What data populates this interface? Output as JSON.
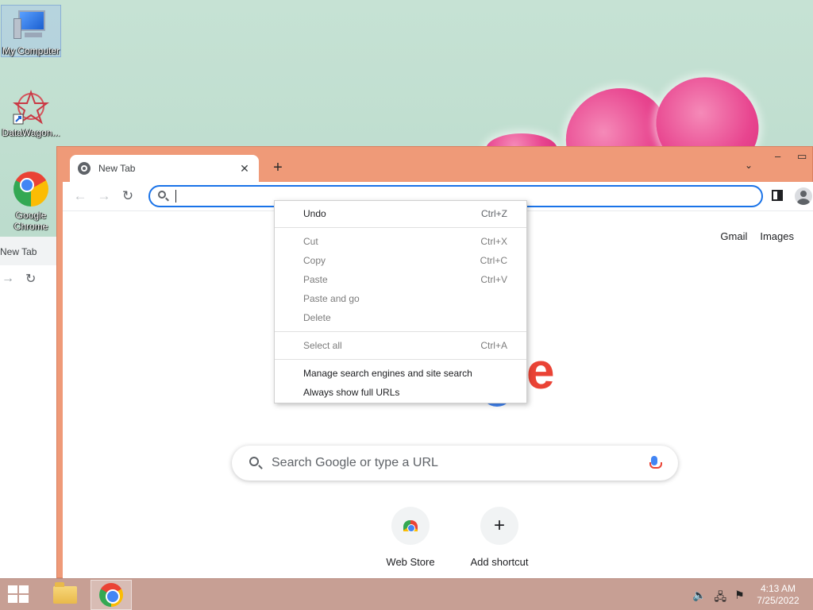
{
  "desktop": {
    "icons": [
      {
        "label": "My Computer"
      },
      {
        "label": "DataWagon..."
      },
      {
        "label": "Google Chrome"
      }
    ]
  },
  "background_window": {
    "tab_label": "New Tab"
  },
  "browser": {
    "tab": {
      "title": "New Tab",
      "close": "✕"
    },
    "new_tab": "+",
    "tab_search": "⌄",
    "window_controls": {
      "minimize": "–",
      "maximize": "▭"
    },
    "nav": {
      "back": "←",
      "forward": "→",
      "reload": "↻"
    },
    "omnibox_value": "",
    "top_links": [
      "Gmail",
      "Images"
    ],
    "logo_fragment": "e",
    "search": {
      "placeholder": "Search Google or type a URL"
    },
    "shortcuts": [
      {
        "label": "Web Store"
      },
      {
        "label": "Add shortcut",
        "icon": "+"
      }
    ]
  },
  "context_menu": {
    "groups": [
      [
        {
          "label": "Undo",
          "shortcut": "Ctrl+Z",
          "enabled": true
        }
      ],
      [
        {
          "label": "Cut",
          "shortcut": "Ctrl+X",
          "enabled": false
        },
        {
          "label": "Copy",
          "shortcut": "Ctrl+C",
          "enabled": false
        },
        {
          "label": "Paste",
          "shortcut": "Ctrl+V",
          "enabled": false
        },
        {
          "label": "Paste and go",
          "shortcut": "",
          "enabled": false
        },
        {
          "label": "Delete",
          "shortcut": "",
          "enabled": false
        }
      ],
      [
        {
          "label": "Select all",
          "shortcut": "Ctrl+A",
          "enabled": false
        }
      ],
      [
        {
          "label": "Manage search engines and site search",
          "shortcut": "",
          "enabled": true
        },
        {
          "label": "Always show full URLs",
          "shortcut": "",
          "enabled": true
        }
      ]
    ]
  },
  "taskbar": {
    "clock_time": "4:13 AM",
    "clock_date": "7/25/2022"
  },
  "colors": {
    "window_frame": "#ef9a78",
    "focus_ring": "#1a73e8",
    "taskbar": "#c79f94"
  }
}
